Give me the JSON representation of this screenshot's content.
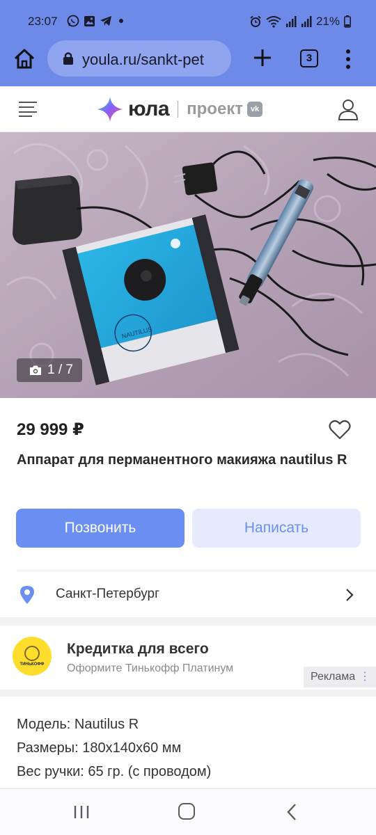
{
  "status_bar": {
    "time": "23:07",
    "battery": "21%"
  },
  "browser": {
    "url": "youla.ru/sankt-pet",
    "tab_count": "3"
  },
  "site_header": {
    "logo_text": "юла",
    "project_text": "проект",
    "vk_badge": "vk"
  },
  "photo": {
    "counter": "1 / 7"
  },
  "item": {
    "price": "29 999 ₽",
    "title": "Аппарат для перманентного макияжа nautilus R",
    "call_label": "Позвонить",
    "message_label": "Написать",
    "location": "Санкт-Петербург"
  },
  "ad": {
    "logo_text": "ТИНЬКОФФ",
    "title": "Кредитка для всего",
    "subtitle": "Оформите Тинькофф Платинум",
    "tag": "Реклама"
  },
  "description": {
    "lines": [
      "Модель: Nautilus R",
      "Размеры: 180х140х60 мм",
      "Вес ручки: 65 гр. (с проводом)"
    ]
  },
  "colors": {
    "browser_chrome": "#6e8ae8",
    "accent": "#6b8ef3",
    "accent_light": "#e5ebfd",
    "tinkoff_yellow": "#ffdd2d"
  },
  "icons": {
    "status_left": [
      "whatsapp-icon",
      "gallery-icon",
      "telegram-icon",
      "dot-icon"
    ],
    "status_right": [
      "alarm-icon",
      "wifi-icon",
      "signal-icon",
      "signal-icon",
      "battery-icon"
    ],
    "browser": [
      "home-icon",
      "lock-icon",
      "plus-icon",
      "tabs-icon",
      "more-vert-icon"
    ],
    "header": [
      "hamburger-icon",
      "yula-star-icon",
      "profile-icon"
    ],
    "item": [
      "camera-icon",
      "heart-icon",
      "location-pin-icon",
      "chevron-right-icon"
    ],
    "navbar": [
      "recent-apps-icon",
      "home-button-icon",
      "back-icon"
    ]
  }
}
